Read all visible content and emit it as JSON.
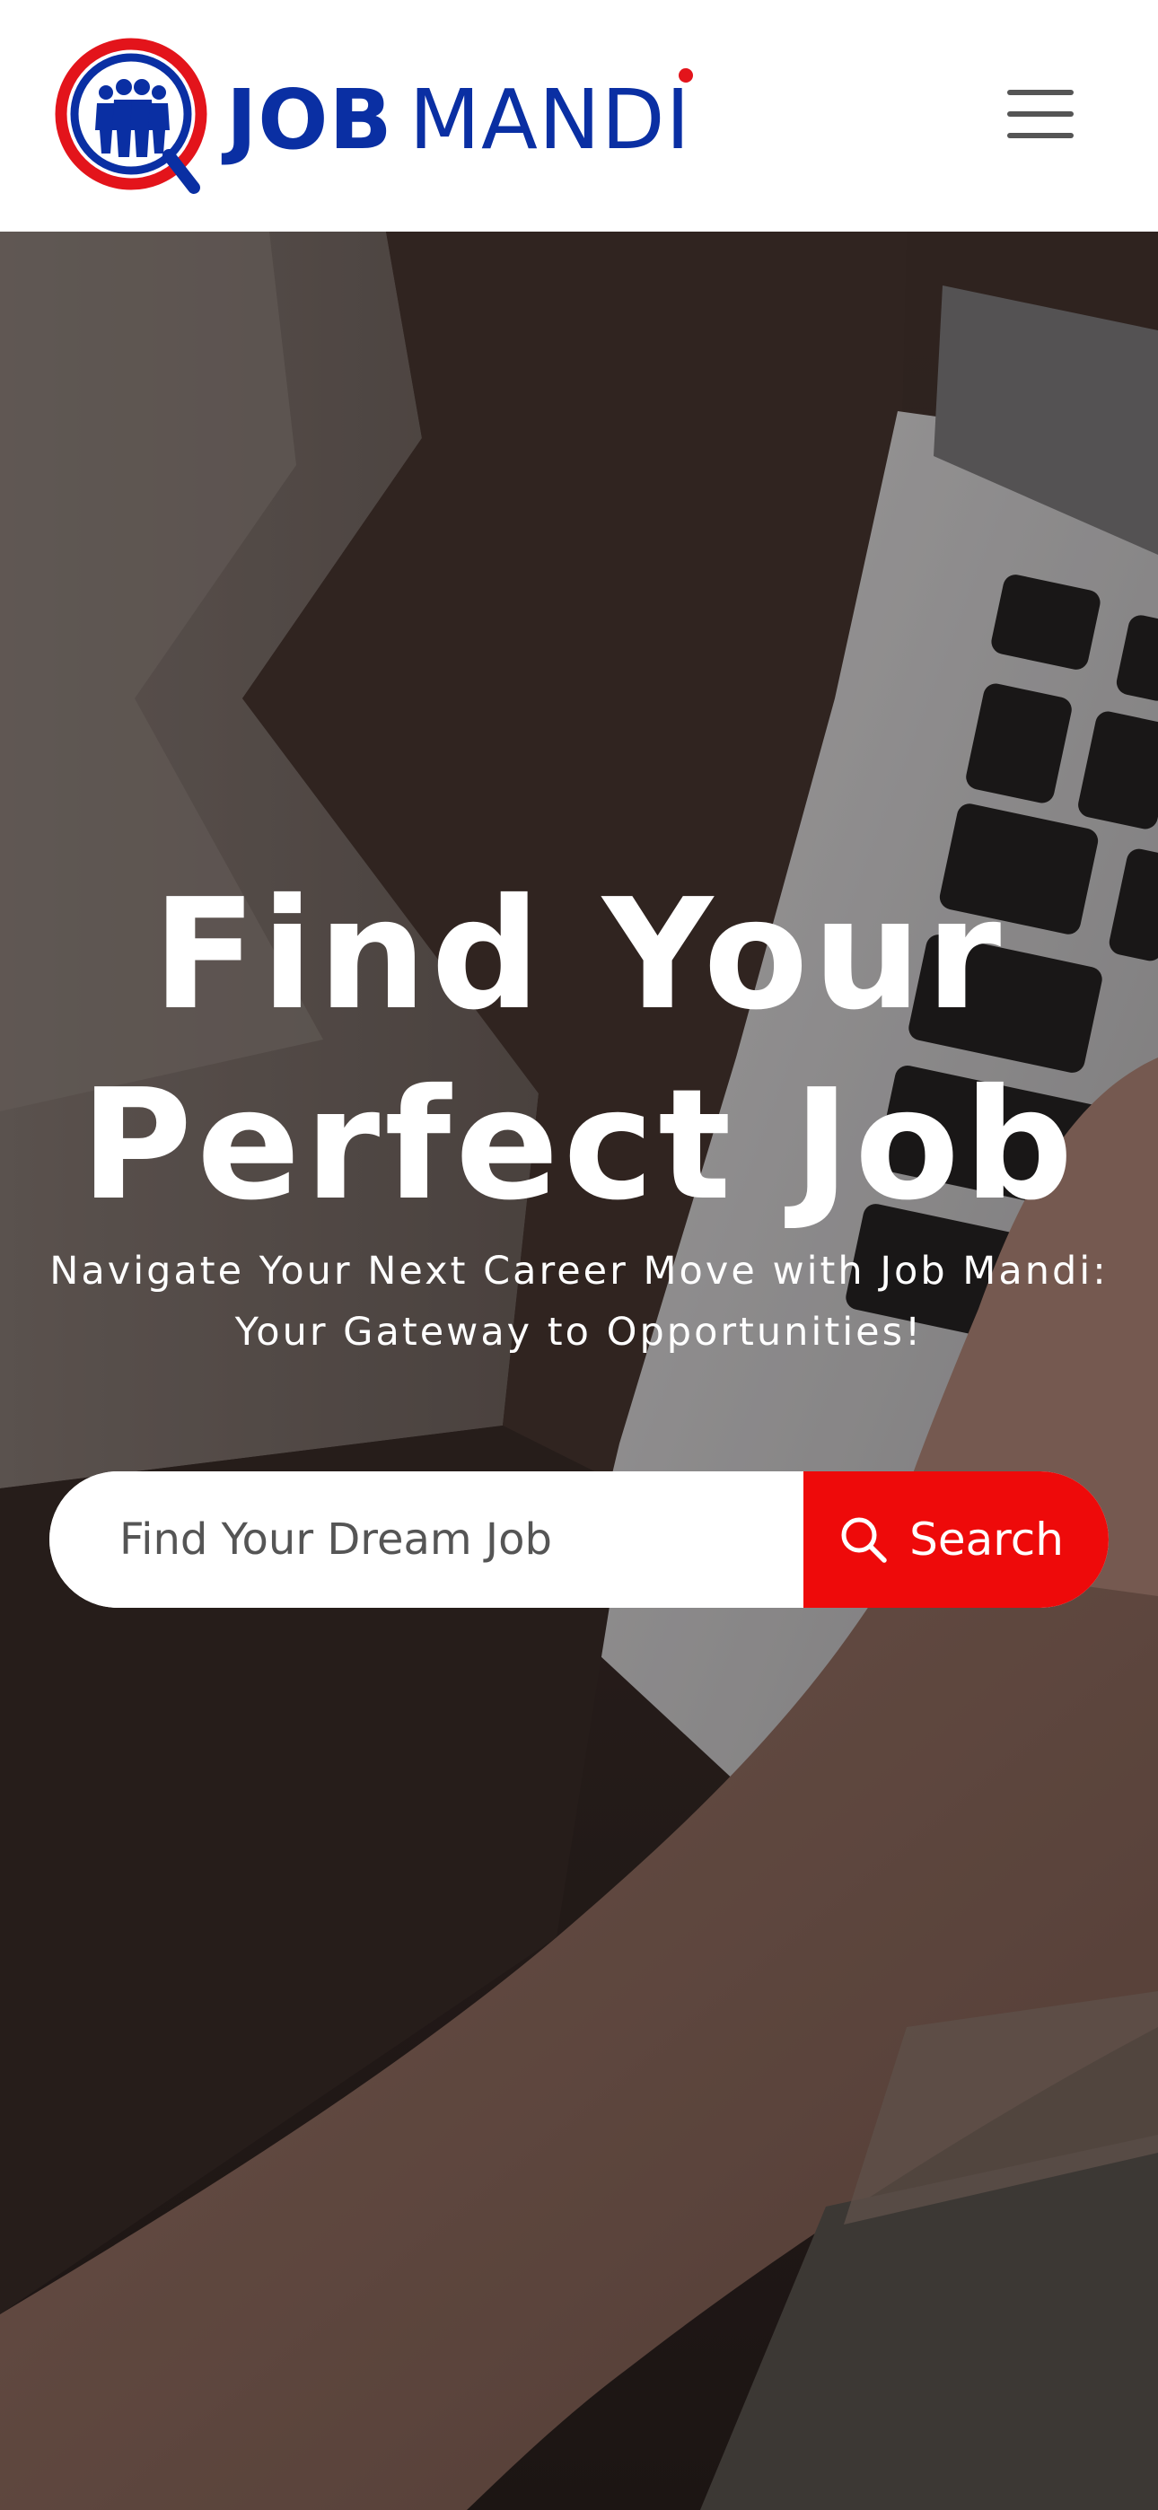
{
  "brand": {
    "name_bold": "JOB",
    "name_light": "MANDI",
    "colors": {
      "blue": "#0a2fa3",
      "red": "#e3141b"
    },
    "logo_icon": "magnifier-people-icon"
  },
  "header": {
    "menu_icon": "hamburger-menu-icon"
  },
  "hero": {
    "title_line1": "Find Your",
    "title_line2": "Perfect Job",
    "subtitle_line1": "Navigate Your Next Career Move with Job Mandi:",
    "subtitle_line2": "Your Gateway to Opportunities!",
    "background": "photo of hands typing on a laptop keyboard"
  },
  "search": {
    "placeholder": "Find Your Dream Job",
    "value": "",
    "button_label": "Search",
    "button_icon": "search-icon",
    "button_color": "#ee0a0a"
  }
}
